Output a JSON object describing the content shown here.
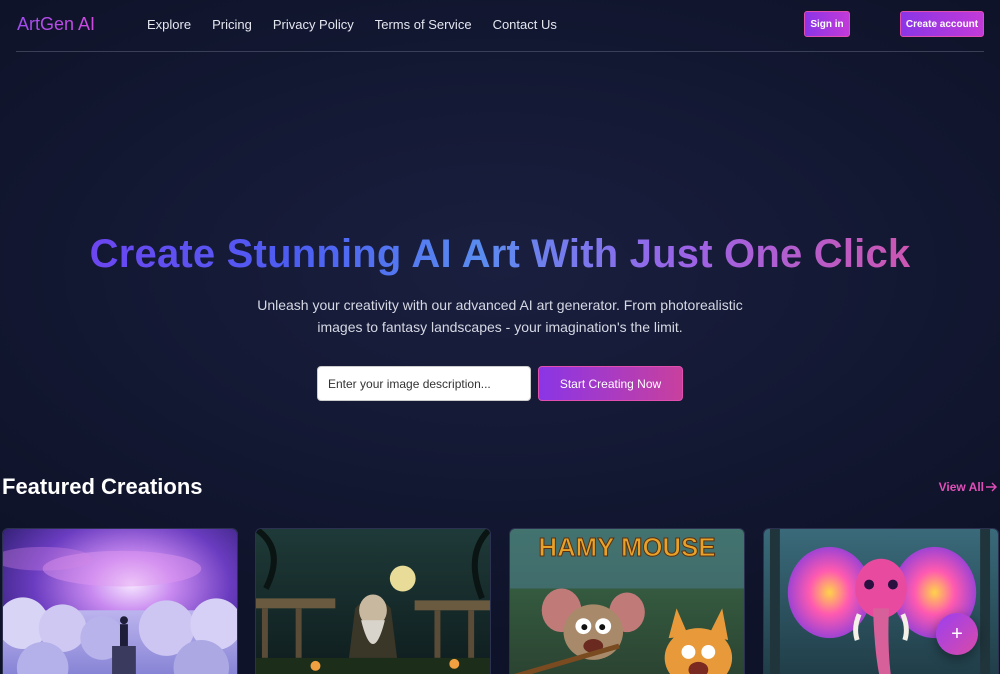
{
  "brand": "ArtGen AI",
  "nav": {
    "links": [
      "Explore",
      "Pricing",
      "Privacy Policy",
      "Terms of Service",
      "Contact Us"
    ],
    "sign_in": "Sign in",
    "create_account": "Create account"
  },
  "hero": {
    "title": "Create Stunning AI Art With Just One Click",
    "subtitle": "Unleash your creativity with our advanced AI art generator. From photorealistic images to fantasy landscapes - your imagination's the limit.",
    "input_placeholder": "Enter your image description...",
    "cta": "Start Creating Now"
  },
  "featured": {
    "title": "Featured Creations",
    "view_all": "View All",
    "view_all_icon": "arrow-right-icon",
    "cards": [
      {
        "name": "cosmic-clouds-artwork"
      },
      {
        "name": "wizard-moonlit-garden-artwork"
      },
      {
        "name": "hamy-mouse-cartoon-artwork",
        "text": "HAMY MOUSE"
      },
      {
        "name": "colorful-elephant-artwork"
      }
    ]
  },
  "fab_icon": "plus-icon",
  "fab_label": "+",
  "colors": {
    "accent_purple": "#8a35e6",
    "accent_pink": "#e04fb8",
    "background": "#131833"
  }
}
